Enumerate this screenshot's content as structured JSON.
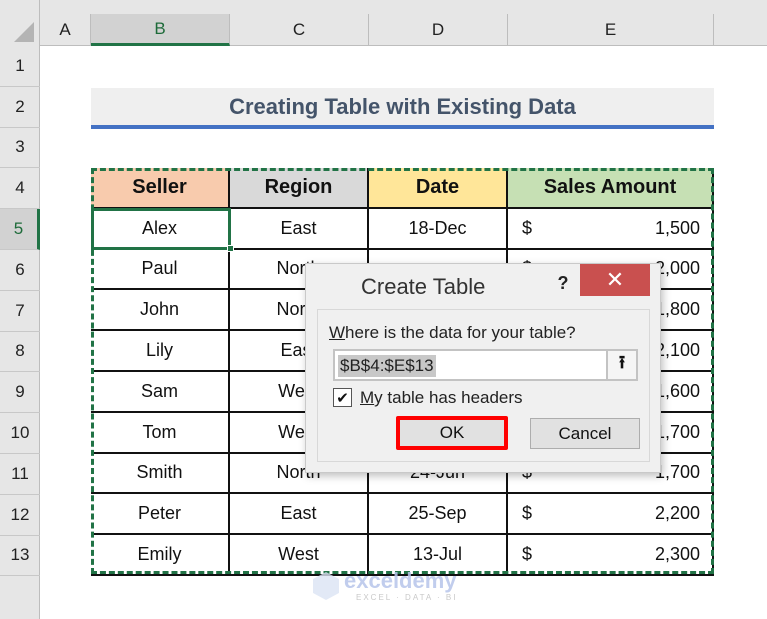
{
  "spreadsheet": {
    "columns": [
      "A",
      "B",
      "C",
      "D",
      "E"
    ],
    "selected_column": "B",
    "rows": [
      "1",
      "2",
      "3",
      "4",
      "5",
      "6",
      "7",
      "8",
      "9",
      "10",
      "11",
      "12",
      "13"
    ],
    "selected_row": "5",
    "title": "Creating Table with Existing Data",
    "table": {
      "headers": [
        "Seller",
        "Region",
        "Date",
        "Sales Amount"
      ],
      "header_colors": [
        "#f8cbad",
        "#d9d9d9",
        "#ffe699",
        "#c6e0b4"
      ],
      "currency_symbol": "$",
      "rows": [
        {
          "seller": "Alex",
          "region": "East",
          "date": "18-Dec",
          "amount": "1,500"
        },
        {
          "seller": "Paul",
          "region": "North",
          "date": "",
          "amount": "2,000"
        },
        {
          "seller": "John",
          "region": "North",
          "date": "",
          "amount": "1,800"
        },
        {
          "seller": "Lily",
          "region": "East",
          "date": "",
          "amount": "2,100"
        },
        {
          "seller": "Sam",
          "region": "West",
          "date": "",
          "amount": "1,600"
        },
        {
          "seller": "Tom",
          "region": "West",
          "date": "",
          "amount": "1,700"
        },
        {
          "seller": "Smith",
          "region": "North",
          "date": "24-Jun",
          "amount": "1,700"
        },
        {
          "seller": "Peter",
          "region": "East",
          "date": "25-Sep",
          "amount": "2,200"
        },
        {
          "seller": "Emily",
          "region": "West",
          "date": "13-Jul",
          "amount": "2,300"
        }
      ]
    }
  },
  "dialog": {
    "title": "Create Table",
    "help_label": "?",
    "close_label": "✕",
    "prompt_underlined": "W",
    "prompt_rest": "here is the data for your table?",
    "range_value": "$B$4:$E$13",
    "collapse_icon": "🠝",
    "checkbox_checked": true,
    "checkbox_mark": "✔",
    "checkbox_label_underlined": "M",
    "checkbox_label_rest": "y table has headers",
    "ok_label": "OK",
    "cancel_label": "Cancel",
    "highlight_color": "#ff0000"
  },
  "watermark": {
    "brand": "exceldemy",
    "tagline": "EXCEL · DATA · BI"
  }
}
